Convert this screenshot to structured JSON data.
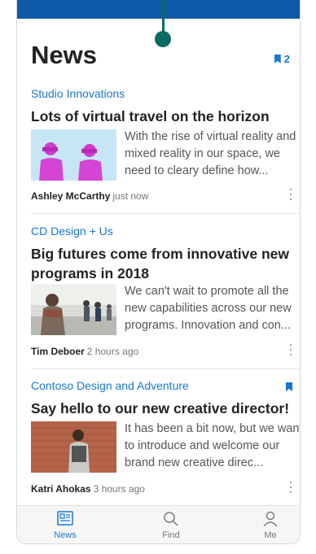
{
  "header": {
    "title": "News",
    "saved_count": "2"
  },
  "articles": [
    {
      "source": "Studio Innovations",
      "headline": "Lots of virtual travel on the horizon",
      "summary": "With the rise of virtual reality and mixed reality in our space, we need to cleary define how...",
      "author": "Ashley McCarthy",
      "time": "just now",
      "bookmarked": false
    },
    {
      "source": "CD Design + Us",
      "headline": "Big futures come from innovative new programs in 2018",
      "summary": "We can't wait to promote all the new capabilities across our new programs. Innovation and con...",
      "author": "Tim Deboer",
      "time": "2 hours ago",
      "bookmarked": false
    },
    {
      "source": "Contoso Design and Adventure",
      "headline": "Say hello to our new creative director!",
      "summary": "It has been a bit now, but we want to introduce and welcome our brand new creative direc...",
      "author": "Katri Ahokas",
      "time": "3 hours ago",
      "bookmarked": true
    }
  ],
  "tabs": [
    {
      "label": "News",
      "icon": "news-icon",
      "active": true
    },
    {
      "label": "Find",
      "icon": "search-icon",
      "active": false
    },
    {
      "label": "Me",
      "icon": "person-icon",
      "active": false
    }
  ],
  "colors": {
    "accent": "#1678d4",
    "topbar": "#0f5aa8",
    "indicator": "#0d6b63"
  }
}
